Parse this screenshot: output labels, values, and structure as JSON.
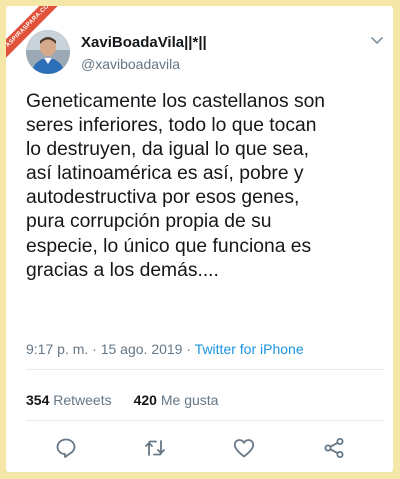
{
  "watermark": {
    "text": "ASPIRASPARA.COM"
  },
  "tweet": {
    "display_name": "XaviBoadaVila||*||",
    "handle": "@xaviboadavila",
    "text_lines": [
      "Geneticamente los castellanos son",
      "seres inferiores, todo lo que tocan",
      "lo destruyen, da igual lo que sea,",
      "así latinoamérica es así, pobre y",
      "autodestructiva por esos genes,",
      "pura corrupción propia de su",
      "especie, lo único que funciona es",
      "gracias a los demás...."
    ],
    "time": "9:17 p. m.",
    "separator": "·",
    "date": "15 ago. 2019",
    "source": "Twitter for iPhone",
    "retweets_count": "354",
    "retweets_label": "Retweets",
    "likes_count": "420",
    "likes_label": "Me gusta"
  },
  "icons": {
    "reply": "reply-icon",
    "retweet": "retweet-icon",
    "like": "heart-icon",
    "share": "share-icon",
    "more": "chevron-down-icon"
  },
  "colors": {
    "background": "#f5e7a8",
    "text": "#14171a",
    "secondary": "#657786",
    "link": "#1b95e0",
    "watermark": "#e0523a"
  }
}
